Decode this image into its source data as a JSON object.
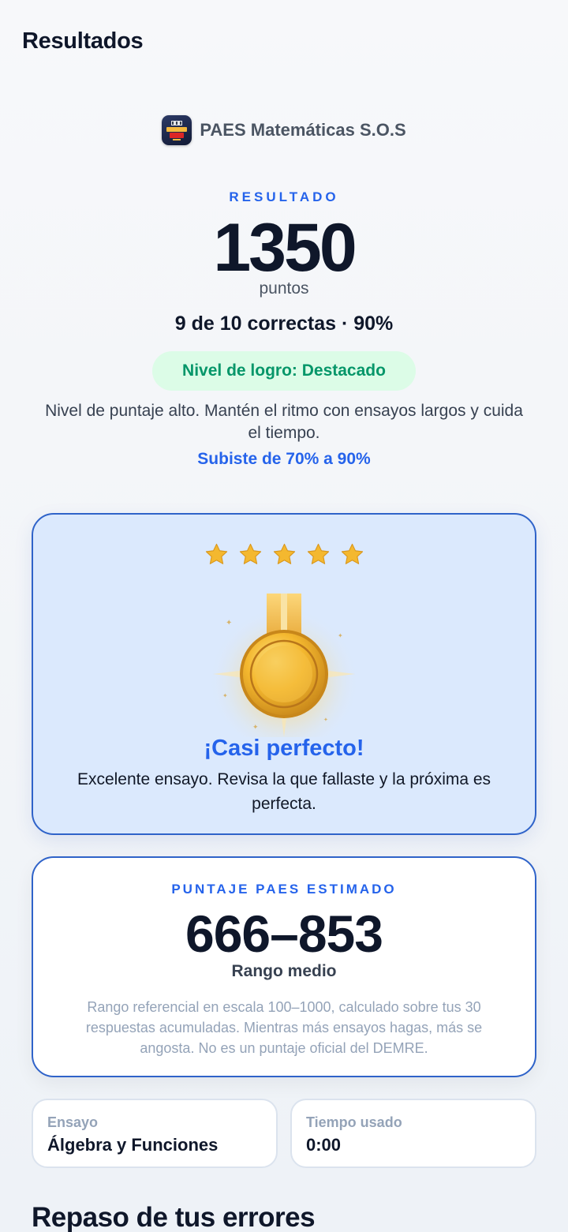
{
  "header": {
    "title": "Resultados"
  },
  "brand": {
    "name": "PAES Matemáticas S.O.S",
    "logo_text": "MATEMÁTICAS S.O.S."
  },
  "result": {
    "kicker": "RESULTADO",
    "score": "1350",
    "unit": "puntos",
    "correct_line": "9 de 10 correctas · 90%",
    "level": "Nivel de logro: Destacado",
    "description": "Nivel de puntaje alto. Mantén el ritmo con ensayos largos y cuida el tiempo.",
    "improvement": "Subiste de 70% a 90%"
  },
  "celebration": {
    "stars_earned": 5,
    "stars_total": 5,
    "title": "¡Casi perfecto!",
    "message": "Excelente ensayo. Revisa la que fallaste y la próxima es perfecta."
  },
  "estimate": {
    "kicker": "PUNTAJE PAES ESTIMADO",
    "range": "666–853",
    "label": "Rango medio",
    "note": "Rango referencial en escala 100–1000, calculado sobre tus 30 respuestas acumuladas. Mientras más ensayos hagas, más se angosta. No es un puntaje oficial del DEMRE."
  },
  "info": {
    "essay_label": "Ensayo",
    "essay_value": "Álgebra y Funciones",
    "time_label": "Tiempo usado",
    "time_value": "0:00"
  },
  "review": {
    "title": "Repaso de tus errores"
  },
  "colors": {
    "accent": "#2563eb",
    "success": "#059669",
    "success_bg": "#dcfce7",
    "card_bg": "#dbe9fd",
    "gold": "#f4b82f"
  },
  "icons": {
    "star": "star-icon",
    "medal": "medal-icon",
    "logo": "app-logo-icon"
  }
}
